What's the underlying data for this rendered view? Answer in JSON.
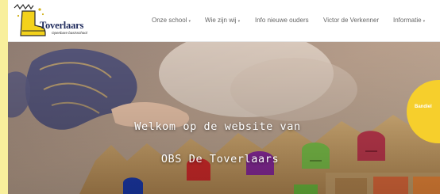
{
  "header": {
    "brand_name": "Toverlaars",
    "tagline": "Openbare basisschool",
    "nav": [
      {
        "label": "Onze school",
        "dropdown": true
      },
      {
        "label": "Wie zijn wij",
        "dropdown": true
      },
      {
        "label": "Info nieuwe ouders",
        "dropdown": false
      },
      {
        "label": "Victor de Verkenner",
        "dropdown": false
      },
      {
        "label": "Informatie",
        "dropdown": true
      }
    ],
    "chevron": "▾"
  },
  "hero": {
    "line1": "Welkom op de website van",
    "line2": "OBS De Toverlaars",
    "badge_text": "Bandiel"
  },
  "colors": {
    "page_bg": "#f8ef9c",
    "accent_yellow": "#f6cf2c",
    "brand_navy": "#1e2a5c"
  }
}
